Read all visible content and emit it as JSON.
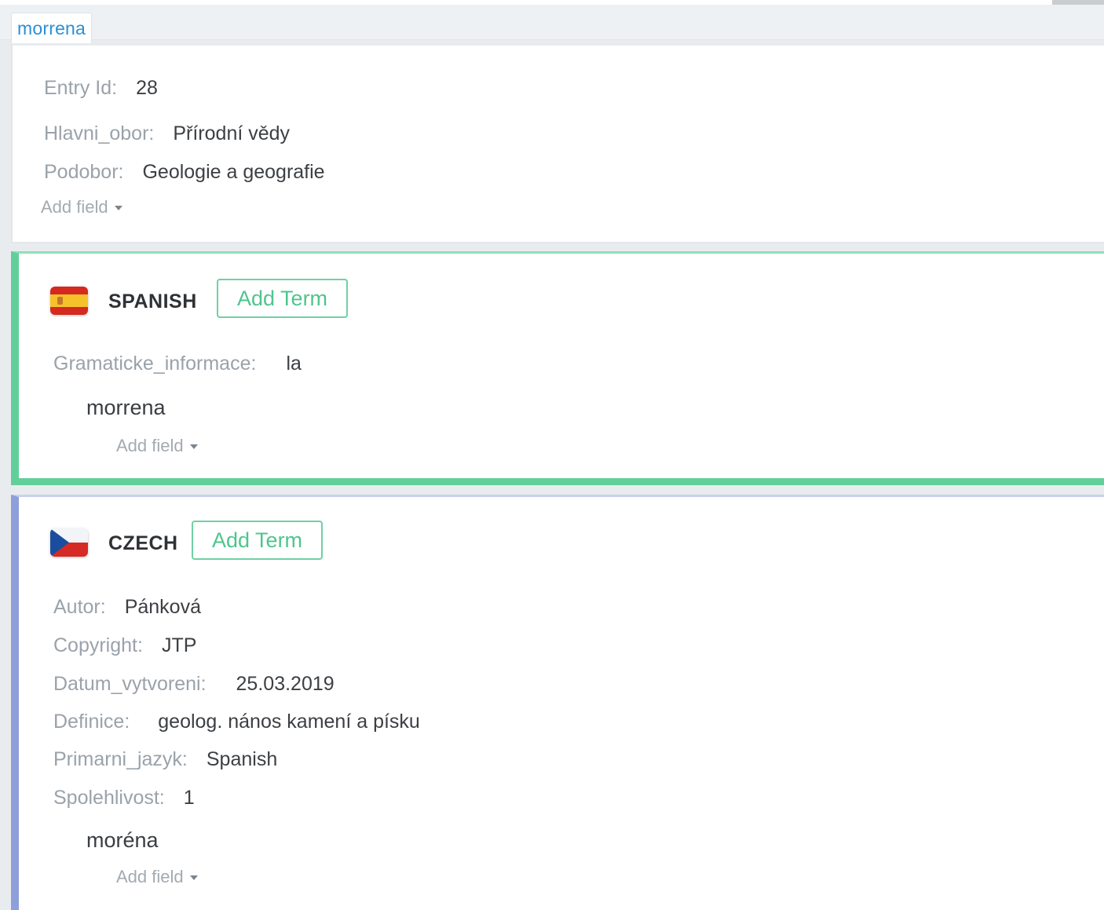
{
  "tab": {
    "label": "morrena"
  },
  "entry": {
    "fields": [
      {
        "label": "Entry Id:",
        "value": "28"
      },
      {
        "label": "Hlavni_obor:",
        "value": "Přírodní vědy"
      },
      {
        "label": "Podobor:",
        "value": "Geologie a geografie"
      }
    ],
    "add_field_label": "Add field"
  },
  "spanish": {
    "language": "SPANISH",
    "flag_icon": "spain-flag-icon",
    "add_term_label": "Add Term",
    "fields": [
      {
        "label": "Gramaticke_informace:",
        "value": "la"
      }
    ],
    "term": "morrena",
    "add_field_label": "Add field"
  },
  "czech": {
    "language": "CZECH",
    "flag_icon": "czech-flag-icon",
    "add_term_label": "Add Term",
    "fields": [
      {
        "label": "Autor:",
        "value": "Pánková"
      },
      {
        "label": "Copyright:",
        "value": "JTP"
      },
      {
        "label": "Datum_vytvoreni:",
        "value": "25.03.2019"
      },
      {
        "label": "Definice:",
        "value": "geolog. nános kamení a písku"
      },
      {
        "label": "Primarni_jazyk:",
        "value": "Spanish"
      },
      {
        "label": "Spolehlivost:",
        "value": "1"
      }
    ],
    "term": "moréna",
    "add_field_label": "Add field"
  },
  "colors": {
    "spanish_accent": "#62cf9a",
    "czech_accent": "#8f9fdc",
    "tab_text": "#2b8fd6",
    "button_green": "#4fc58d"
  }
}
